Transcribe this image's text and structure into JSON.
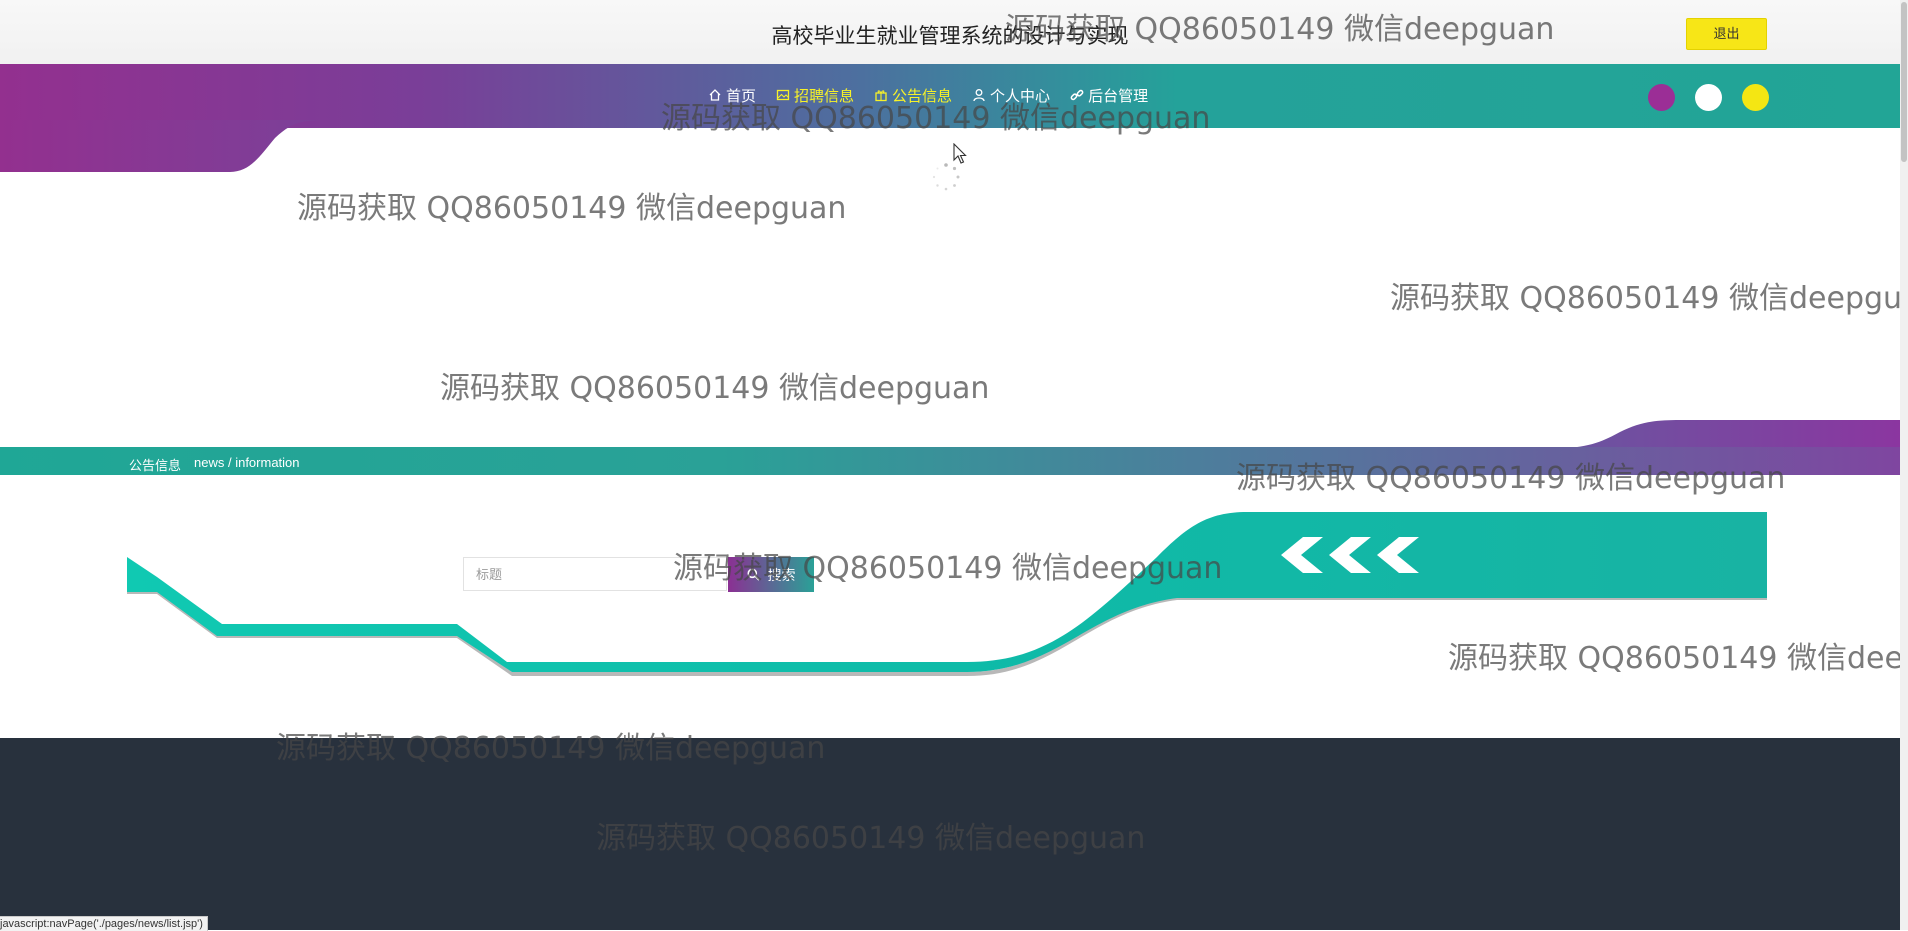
{
  "header": {
    "site_title": "高校毕业生就业管理系统的设计与实现",
    "logout_label": "退出"
  },
  "nav": {
    "items": [
      {
        "label": "首页",
        "icon": "home-icon"
      },
      {
        "label": "招聘信息",
        "icon": "picture-icon"
      },
      {
        "label": "公告信息",
        "icon": "gift-icon"
      },
      {
        "label": "个人中心",
        "icon": "user-icon"
      },
      {
        "label": "后台管理",
        "icon": "link-icon"
      }
    ],
    "active_color": "#f7f228",
    "theme_colors": [
      "#9b2e96",
      "#ffffff",
      "#f4e613"
    ]
  },
  "news_section": {
    "title": "公告信息",
    "subtitle": "news / information"
  },
  "search": {
    "placeholder": "标题",
    "button_label": "搜索"
  },
  "status_bar": {
    "url": "javascript:navPage('./pages/news/list.jsp')"
  },
  "watermark_text": "源码获取 QQ86050149 微信deepguan",
  "colors": {
    "purple": "#93308f",
    "teal": "#22a596",
    "banner_teal": "#14c4b0",
    "footer": "#28313d",
    "logout_yellow": "#f7e617"
  }
}
